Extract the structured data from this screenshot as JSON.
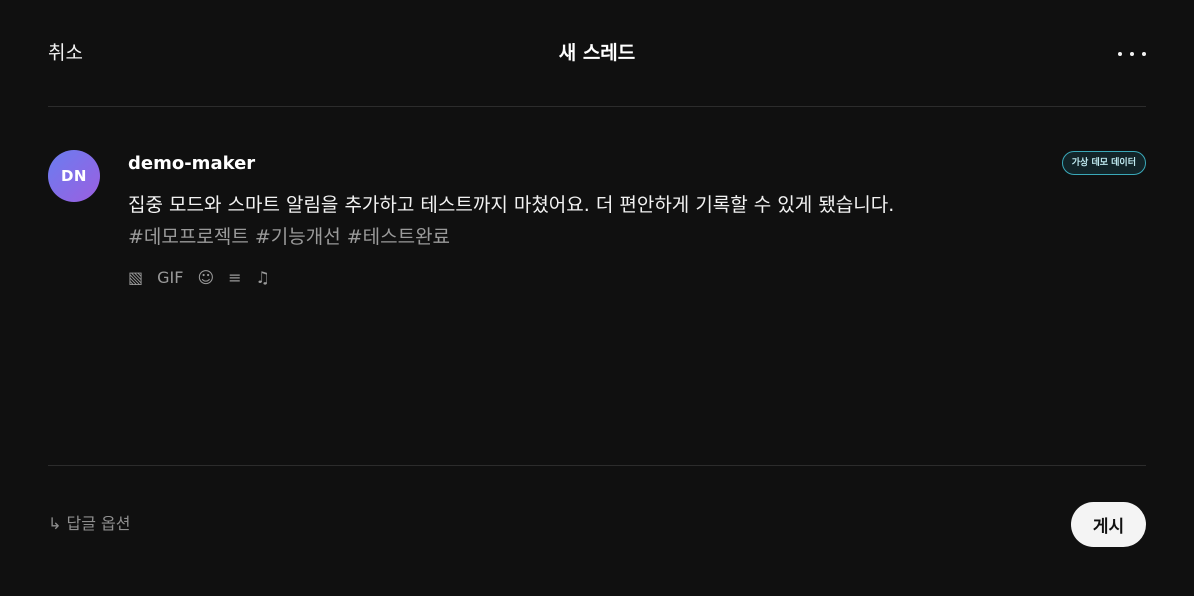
{
  "header": {
    "cancel_label": "취소",
    "title": "새 스레드",
    "more_icon": "more-horizontal-icon"
  },
  "composer": {
    "avatar_initials": "DN",
    "avatar_gradient": [
      "#6a7df0",
      "#9b5fe0"
    ],
    "username": "demo-maker",
    "badge": "가상 데모 데이터",
    "badge_color": "#3aa8b8",
    "text": "집중 모드와 스마트 알림을 추가하고 테스트까지 마쳤어요. 더 편안하게 기록할 수 있게 됐습니다.",
    "hashtags": "#데모프로젝트 #기능개선 #테스트완료",
    "tools": {
      "image": "▧",
      "gif": "GIF",
      "emoji": "☺",
      "list": "≡",
      "music": "♫"
    }
  },
  "footer": {
    "reply_options": "↳ 답글 옵션",
    "post_label": "게시"
  }
}
